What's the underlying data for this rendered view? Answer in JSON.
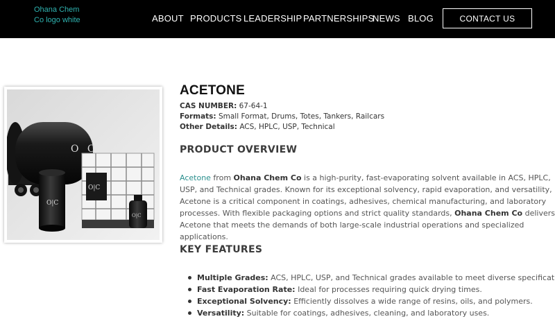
{
  "header": {
    "logo_alt": "Ohana Chem Co logo white",
    "nav": [
      "ABOUT",
      "PRODUCTS",
      "LEADERSHIP",
      "PARTNERSHIPS",
      "NEWS",
      "BLOG"
    ],
    "cta": "CONTACT US"
  },
  "product": {
    "image_brand_mark": "O|C",
    "title": "ACETONE",
    "cas_label": "CAS NUMBER:",
    "cas_value": "67-64-1",
    "formats_label": "Formats:",
    "formats_value": "Small Format, Drums, Totes, Tankers, Railcars",
    "other_label": "Other Details:",
    "other_value": "ACS, HPLC, USP, Technical"
  },
  "overview": {
    "heading": "PRODUCT OVERVIEW",
    "link_text": "Acetone",
    "t1": " from ",
    "brand1": "Ohana Chem Co",
    "t2": " is a high-purity, fast-evaporating solvent available in ACS, HPLC, USP, and Technical grades. Known for its exceptional solvency, rapid evaporation, and versatility, Acetone is a critical component in coatings, adhesives, chemical manufacturing, and laboratory processes. With flexible packaging options and strict quality standards, ",
    "brand2": "Ohana Chem Co",
    "t3": " delivers Acetone that meets the demands of both large-scale industrial operations and specialized applications."
  },
  "features": {
    "heading": "KEY FEATURES",
    "items": [
      {
        "label": "Multiple Grades:",
        "text": " ACS, HPLC, USP, and Technical grades available to meet diverse specifications."
      },
      {
        "label": "Fast Evaporation Rate:",
        "text": " Ideal for processes requiring quick drying times."
      },
      {
        "label": "Exceptional Solvency:",
        "text": " Efficiently dissolves a wide range of resins, oils, and polymers."
      },
      {
        "label": "Versatility:",
        "text": " Suitable for coatings, adhesives, cleaning, and laboratory uses."
      }
    ]
  }
}
